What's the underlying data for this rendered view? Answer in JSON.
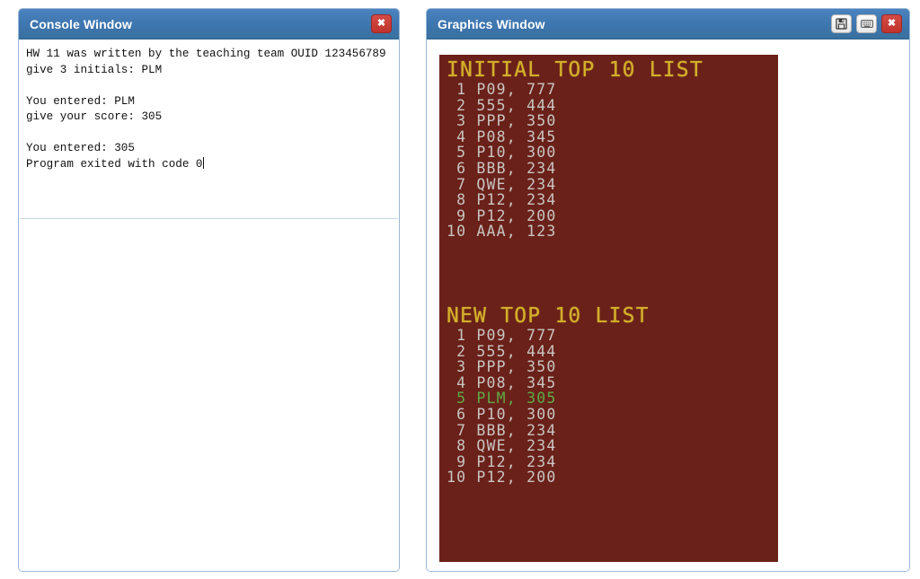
{
  "console_window": {
    "title": "Console Window",
    "close_button": {
      "name": "close-icon",
      "glyph": "✖"
    },
    "output_lines": [
      "HW 11 was written by the teaching team OUID 123456789",
      "give 3 initials: PLM",
      "",
      "You entered: PLM",
      "give your score: 305",
      "",
      "You entered: 305",
      "Program exited with code 0"
    ],
    "output_text": "HW 11 was written by the teaching team OUID 123456789\ngive 3 initials: PLM\n\nYou entered: PLM\ngive your score: 305\n\nYou entered: 305\nProgram exited with code 0"
  },
  "graphics_window": {
    "title": "Graphics Window",
    "buttons": [
      {
        "name": "save-icon",
        "label": "Save"
      },
      {
        "name": "keyboard-icon",
        "label": "Keyboard"
      },
      {
        "name": "close-icon",
        "label": "Close",
        "glyph": "✖"
      }
    ],
    "canvas": {
      "background_color": "#6a2119",
      "header_color": "#d4af2b",
      "entry_color": "#c9c5c2",
      "highlight_color": "#5faa46",
      "initial_list": {
        "header": "INITIAL TOP 10 LIST",
        "rows": [
          {
            "rank": "1",
            "initials": "P09",
            "score": "777",
            "highlight": false
          },
          {
            "rank": "2",
            "initials": "555",
            "score": "444",
            "highlight": false
          },
          {
            "rank": "3",
            "initials": "PPP",
            "score": "350",
            "highlight": false
          },
          {
            "rank": "4",
            "initials": "P08",
            "score": "345",
            "highlight": false
          },
          {
            "rank": "5",
            "initials": "P10",
            "score": "300",
            "highlight": false
          },
          {
            "rank": "6",
            "initials": "BBB",
            "score": "234",
            "highlight": false
          },
          {
            "rank": "7",
            "initials": "QWE",
            "score": "234",
            "highlight": false
          },
          {
            "rank": "8",
            "initials": "P12",
            "score": "234",
            "highlight": false
          },
          {
            "rank": "9",
            "initials": "P12",
            "score": "200",
            "highlight": false
          },
          {
            "rank": "10",
            "initials": "AAA",
            "score": "123",
            "highlight": false
          }
        ]
      },
      "new_list": {
        "header": "NEW TOP 10 LIST",
        "rows": [
          {
            "rank": "1",
            "initials": "P09",
            "score": "777",
            "highlight": false
          },
          {
            "rank": "2",
            "initials": "555",
            "score": "444",
            "highlight": false
          },
          {
            "rank": "3",
            "initials": "PPP",
            "score": "350",
            "highlight": false
          },
          {
            "rank": "4",
            "initials": "P08",
            "score": "345",
            "highlight": false
          },
          {
            "rank": "5",
            "initials": "PLM",
            "score": "305",
            "highlight": true
          },
          {
            "rank": "6",
            "initials": "P10",
            "score": "300",
            "highlight": false
          },
          {
            "rank": "7",
            "initials": "BBB",
            "score": "234",
            "highlight": false
          },
          {
            "rank": "8",
            "initials": "QWE",
            "score": "234",
            "highlight": false
          },
          {
            "rank": "9",
            "initials": "P12",
            "score": "234",
            "highlight": false
          },
          {
            "rank": "10",
            "initials": "P12",
            "score": "200",
            "highlight": false
          }
        ]
      }
    }
  }
}
